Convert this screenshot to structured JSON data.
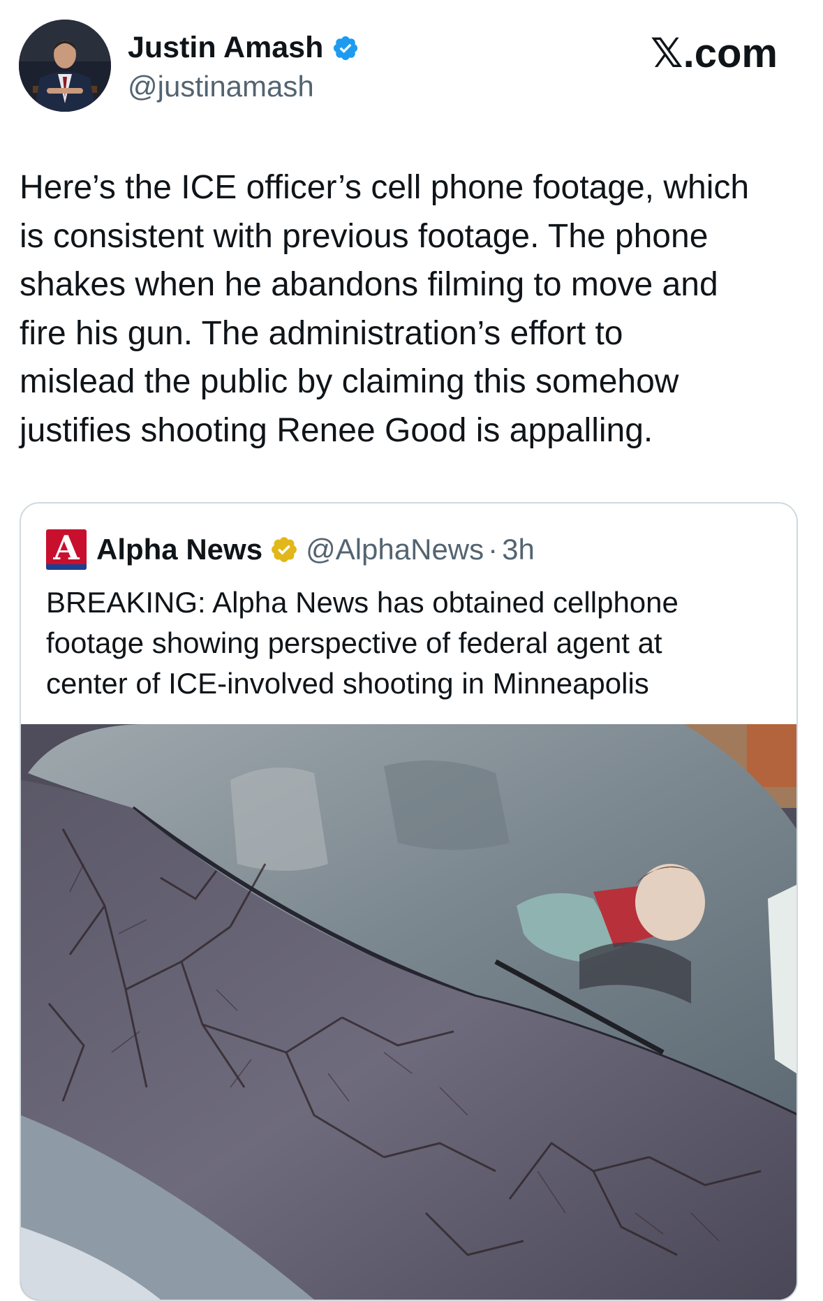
{
  "author": {
    "name": "Justin Amash",
    "handle": "@justinamash",
    "verified_color": "#1d9bf0"
  },
  "site_brand": "𝕏.com",
  "tweet": {
    "lines": [
      "Here’s the ICE officer’s cell phone footage, which",
      "is consistent with previous footage. The phone",
      "shakes when he abandons filming to move and",
      "fire his gun. The administration’s effort to",
      "mislead the public by claiming this somehow",
      "justifies shooting Renee Good is appalling."
    ]
  },
  "quoted": {
    "logo_letter": "A",
    "name": "Alpha News",
    "handle": "@AlphaNews",
    "separator": "·",
    "time": "3h",
    "verified_color": "#e2b719",
    "lines": [
      "BREAKING: Alpha News has obtained cellphone",
      "footage showing perspective of federal agent at",
      "center of ICE-involved shooting in Minneapolis"
    ]
  },
  "icons": {
    "author_verified": "verified-badge-icon",
    "quoted_verified": "gold-verified-badge-icon"
  }
}
